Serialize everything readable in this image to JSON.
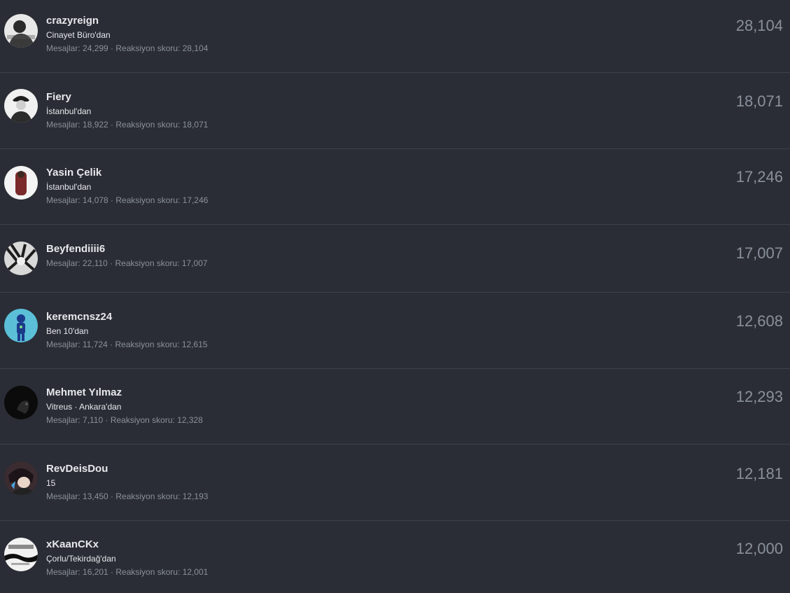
{
  "members": [
    {
      "name": "crazyreign",
      "location": "Cinayet Büro'dan",
      "stats": "Mesajlar: 24,299 · Reaksiyon skoru: 28,104",
      "score": "28,104",
      "avatar_icon": "user-avatar-icon"
    },
    {
      "name": "Fiery",
      "location": "İstanbul'dan",
      "stats": "Mesajlar: 18,922 · Reaksiyon skoru: 18,071",
      "score": "18,071",
      "avatar_icon": "user-avatar-icon"
    },
    {
      "name": "Yasin Çelik",
      "location": "İstanbul'dan",
      "stats": "Mesajlar: 14,078 · Reaksiyon skoru: 17,246",
      "score": "17,246",
      "avatar_icon": "user-avatar-icon"
    },
    {
      "name": "Beyfendiiii6",
      "location": "",
      "stats": "Mesajlar: 22,110 · Reaksiyon skoru: 17,007",
      "score": "17,007",
      "avatar_icon": "user-avatar-icon"
    },
    {
      "name": "keremcnsz24",
      "location": "Ben 10'dan",
      "stats": "Mesajlar: 11,724 · Reaksiyon skoru: 12,615",
      "score": "12,608",
      "avatar_icon": "user-avatar-icon"
    },
    {
      "name": "Mehmet Yılmaz",
      "location": "Vitreus · Ankara'dan",
      "stats": "Mesajlar: 7,110 · Reaksiyon skoru: 12,328",
      "score": "12,293",
      "avatar_icon": "user-avatar-icon"
    },
    {
      "name": "RevDeisDou",
      "location": "15",
      "stats": "Mesajlar: 13,450 · Reaksiyon skoru: 12,193",
      "score": "12,181",
      "avatar_icon": "user-avatar-icon"
    },
    {
      "name": "xKaanCKx",
      "location": "Çorlu/Tekirdağ'dan",
      "stats": "Mesajlar: 16,201 · Reaksiyon skoru: 12,001",
      "score": "12,000",
      "avatar_icon": "user-avatar-icon"
    }
  ]
}
